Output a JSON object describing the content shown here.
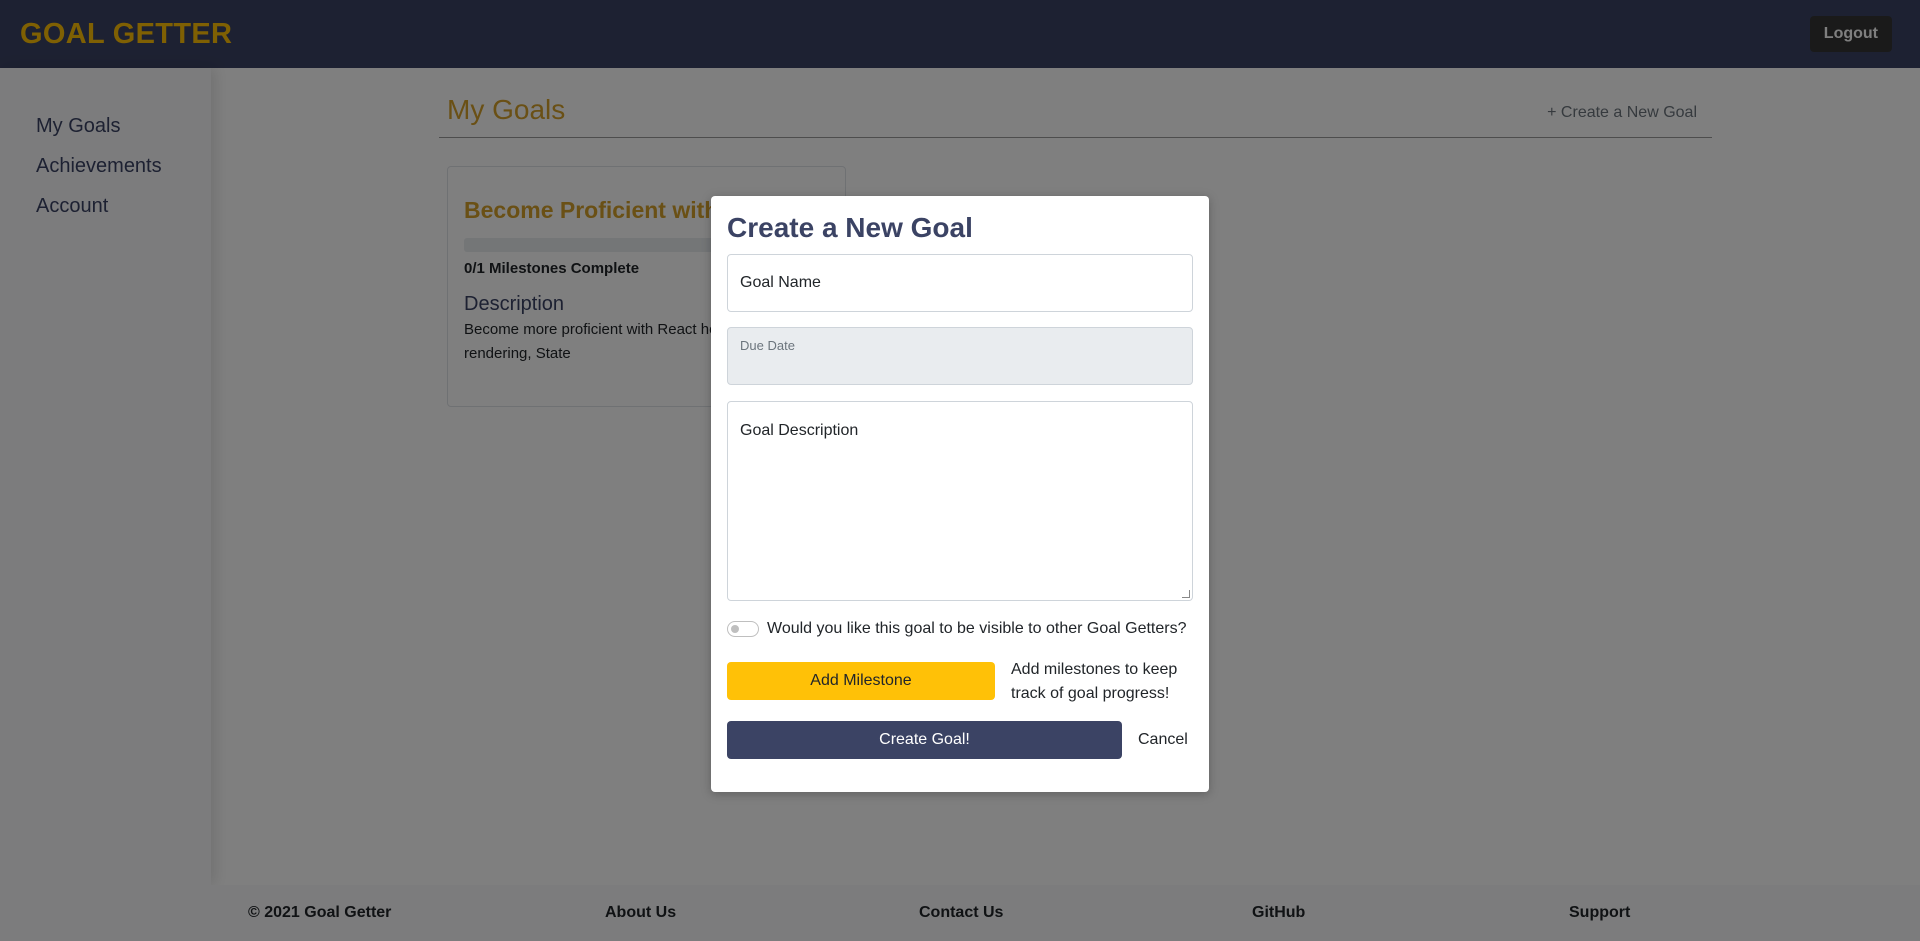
{
  "navbar": {
    "brand": "GOAL GETTER",
    "logout_label": "Logout"
  },
  "sidebar": {
    "items": [
      {
        "label": "My Goals"
      },
      {
        "label": "Achievements"
      },
      {
        "label": "Account"
      }
    ]
  },
  "main": {
    "title": "My Goals",
    "new_goal_link": "+ Create a New Goal",
    "goal_card": {
      "title": "Become Proficient with React",
      "progress_fraction": 0,
      "milestones_status": "0/1 Milestones Complete",
      "description_heading": "Description",
      "description_text": "Become more proficient with React hooks, conditional rendering, State"
    }
  },
  "footer": {
    "items": [
      {
        "label": "© 2021 Goal Getter"
      },
      {
        "label": "About Us"
      },
      {
        "label": "Contact Us"
      },
      {
        "label": "GitHub"
      },
      {
        "label": "Support"
      }
    ]
  },
  "modal": {
    "title": "Create a New Goal",
    "goal_name_placeholder": "Goal Name",
    "due_date_label": "Due Date",
    "goal_description_placeholder": "Goal Description",
    "visibility_toggle_label": "Would you like this goal to be visible to other Goal Getters?",
    "visibility_on": false,
    "add_milestone_label": "Add Milestone",
    "milestone_hint": "Add milestones to keep track of goal progress!",
    "create_label": "Create Goal!",
    "cancel_label": "Cancel"
  },
  "colors": {
    "navy": "#3b4364",
    "gold": "#ffc107",
    "title_gold": "#d4a02a"
  }
}
